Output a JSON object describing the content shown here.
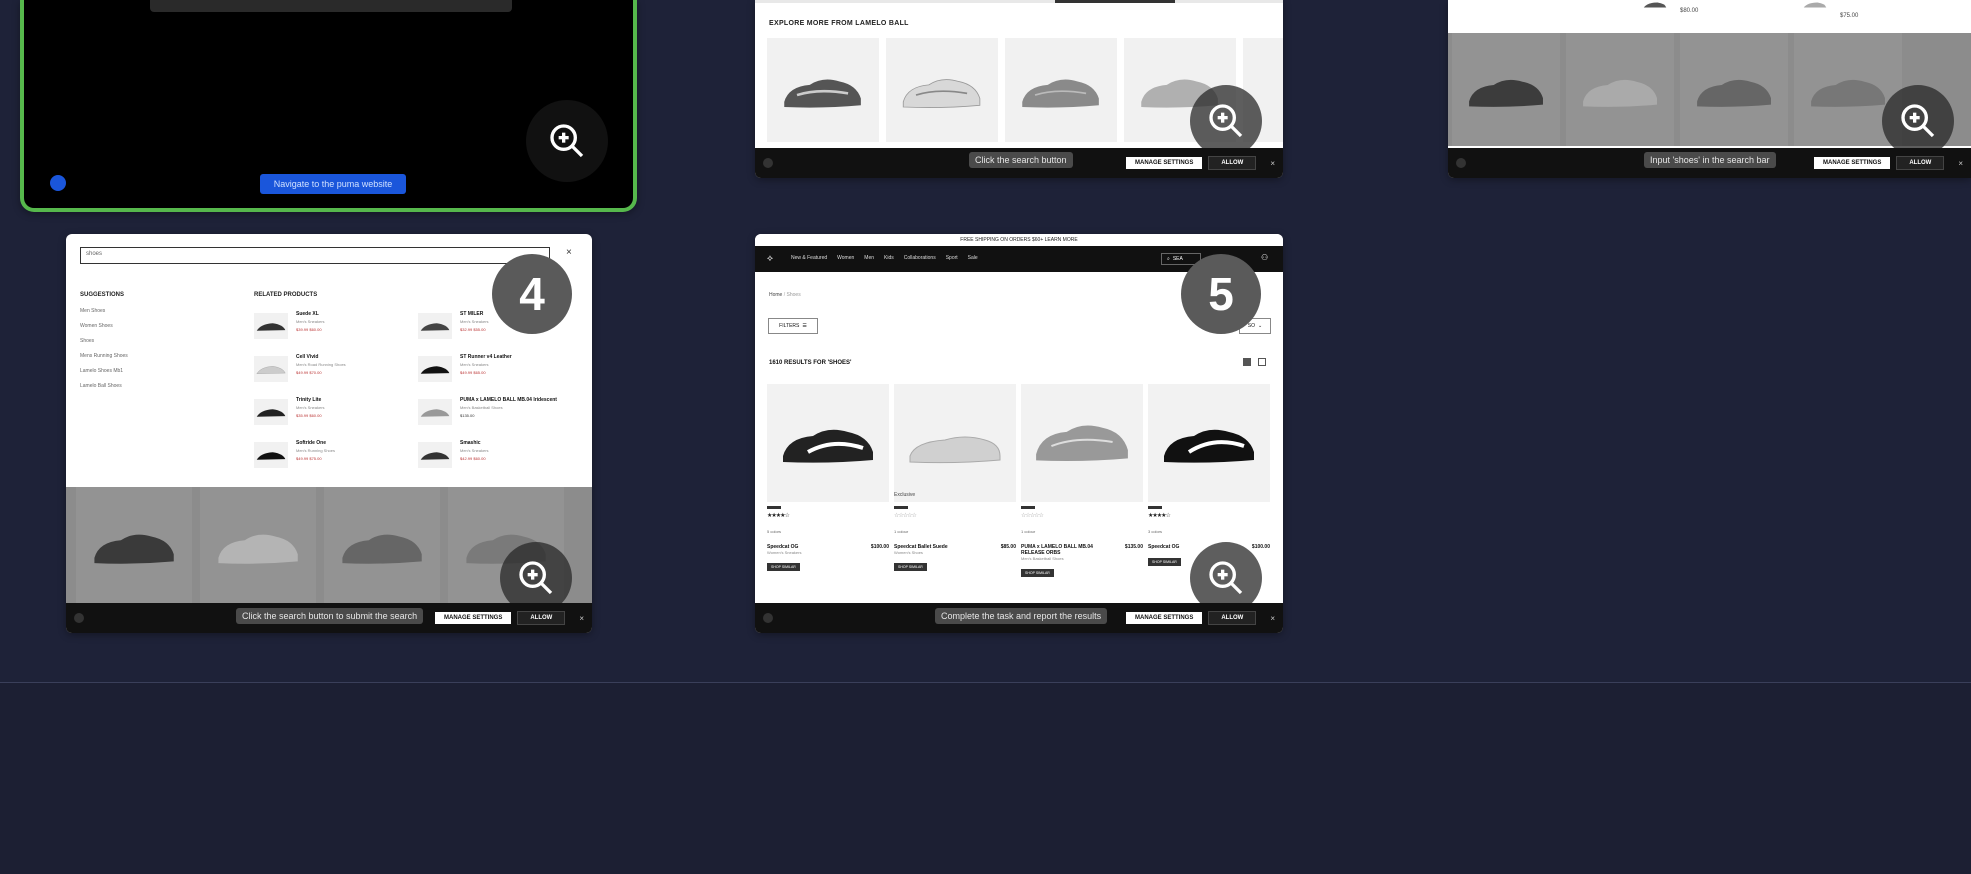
{
  "step1": {
    "tooltip": "Navigate to the puma website"
  },
  "step2": {
    "section_title": "EXPLORE MORE FROM LAMELO BALL",
    "tooltip": "Click the search button",
    "manage_settings": "MANAGE SETTINGS",
    "allow": "ALLOW",
    "close": "×"
  },
  "step3": {
    "tooltip": "Input 'shoes' in the search bar",
    "manage_settings": "MANAGE SETTINGS",
    "allow": "ALLOW",
    "close": "×",
    "price1": "$80.00",
    "price2": "$75.00"
  },
  "step4": {
    "badge": "4",
    "search_value": "shoes",
    "close": "×",
    "suggestions_title": "SUGGESTIONS",
    "suggestions": [
      "Men Shoes",
      "Women Shoes",
      "Shoes",
      "Mens Running Shoes",
      "Lamelo Shoes Mb1",
      "Lamelo Ball Shoes"
    ],
    "related_title": "RELATED PRODUCTS",
    "related": [
      {
        "name": "Suede XL",
        "sub": "Men's Sneakers",
        "price": "$39.99  $60.00"
      },
      {
        "name": "ST MILER",
        "sub": "Men's Sneakers",
        "price": "$32.99  $55.00"
      },
      {
        "name": "Cell Vivid",
        "sub": "Men's Road Running Shoes",
        "price": "$49.99  $70.00"
      },
      {
        "name": "ST Runner v4 Leather",
        "sub": "Men's Sneakers",
        "price": "$49.99  $65.00"
      },
      {
        "name": "Trinity Lite",
        "sub": "Men's Sneakers",
        "price": "$35.99  $60.00"
      },
      {
        "name": "PUMA x LAMELO BALL MB.04 Iridescent",
        "sub": "Men's Basketball Shoes",
        "price": "$135.00"
      },
      {
        "name": "Softride One",
        "sub": "Men's Running Shoes",
        "price": "$49.99  $75.00"
      },
      {
        "name": "Smashic",
        "sub": "Men's Sneakers",
        "price": "$42.99  $60.00"
      }
    ],
    "tooltip": "Click the search button to submit the search",
    "manage_settings": "MANAGE SETTINGS",
    "allow": "ALLOW",
    "bottom_close": "×"
  },
  "step5": {
    "badge": "5",
    "promo": "FREE SHIPPING ON ORDERS $60+  LEARN MORE",
    "nav": [
      "New & Featured",
      "Women",
      "Men",
      "Kids",
      "Collaborations",
      "Sport",
      "Sale"
    ],
    "search_label": "SEA",
    "breadcrumb_home": "Home",
    "breadcrumb_current": "Shoes",
    "filters": "FILTERS",
    "sort": "SO",
    "results_title": "1610 RESULTS FOR 'SHOES'",
    "products": [
      {
        "name": "Speedcat OG",
        "sub": "Women's Sneakers",
        "price": "$100.00",
        "swatch": "5 colors",
        "shop": "SHOP SIMILAR"
      },
      {
        "name": "Speedcat Ballet Suede",
        "sub": "Women's Shoes",
        "price": "$85.00",
        "swatch": "1 colour",
        "shop": "SHOP SIMILAR",
        "label": "Exclusive"
      },
      {
        "name": "PUMA x LAMELO BALL MB.04 RELEASE ORBS",
        "sub": "Men's Basketball Shoes",
        "price": "$135.00",
        "swatch": "1 colour",
        "shop": "SHOP SIMILAR"
      },
      {
        "name": "Speedcat OG",
        "sub": "",
        "price": "$100.00",
        "swatch": "3 colors",
        "shop": "SHOP SIMILAR"
      }
    ],
    "tooltip": "Complete the task and report the results",
    "manage_settings": "MANAGE SETTINGS",
    "allow": "ALLOW",
    "close": "×"
  },
  "colors": {
    "background": "#1e2238",
    "active_border": "#4caf50",
    "primary_button": "#1a56db"
  }
}
